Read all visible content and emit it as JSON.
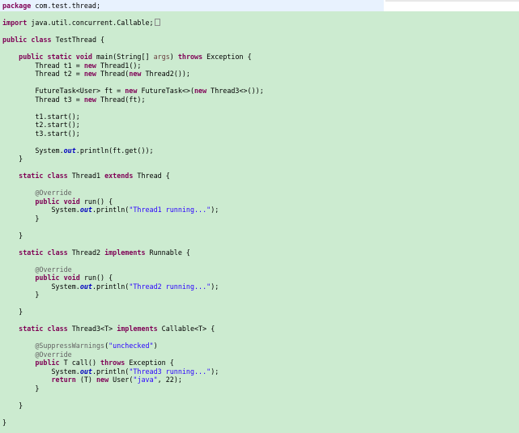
{
  "editor": {
    "language": "java",
    "colors": {
      "background": "#ccebd0",
      "current_line": "#e8f2fe",
      "keyword": "#7f0055",
      "string": "#2a00ff",
      "annotation": "#646464",
      "static_field": "#0000c0",
      "unused_param": "#6a3e3e"
    },
    "lines": [
      [
        {
          "t": "kw",
          "v": "package"
        },
        {
          "t": "plain",
          "v": " com.test.thread;"
        }
      ],
      [],
      [
        {
          "t": "kw",
          "v": "import"
        },
        {
          "t": "plain",
          "v": " java.util.concurrent.Callable;"
        }
      ],
      [],
      [
        {
          "t": "kw",
          "v": "public"
        },
        {
          "t": "plain",
          "v": " "
        },
        {
          "t": "kw",
          "v": "class"
        },
        {
          "t": "plain",
          "v": " TestThread {"
        }
      ],
      [],
      [
        {
          "t": "plain",
          "v": "    "
        },
        {
          "t": "kw",
          "v": "public"
        },
        {
          "t": "plain",
          "v": " "
        },
        {
          "t": "kw",
          "v": "static"
        },
        {
          "t": "plain",
          "v": " "
        },
        {
          "t": "kw",
          "v": "void"
        },
        {
          "t": "plain",
          "v": " main(String[] "
        },
        {
          "t": "var",
          "v": "args"
        },
        {
          "t": "plain",
          "v": ") "
        },
        {
          "t": "kw",
          "v": "throws"
        },
        {
          "t": "plain",
          "v": " Exception {"
        }
      ],
      [
        {
          "t": "plain",
          "v": "        Thread t1 = "
        },
        {
          "t": "kw",
          "v": "new"
        },
        {
          "t": "plain",
          "v": " Thread1();"
        }
      ],
      [
        {
          "t": "plain",
          "v": "        Thread t2 = "
        },
        {
          "t": "kw",
          "v": "new"
        },
        {
          "t": "plain",
          "v": " Thread("
        },
        {
          "t": "kw",
          "v": "new"
        },
        {
          "t": "plain",
          "v": " Thread2());"
        }
      ],
      [],
      [
        {
          "t": "plain",
          "v": "        FutureTask<User> ft = "
        },
        {
          "t": "kw",
          "v": "new"
        },
        {
          "t": "plain",
          "v": " FutureTask<>("
        },
        {
          "t": "kw",
          "v": "new"
        },
        {
          "t": "plain",
          "v": " Thread3<>());"
        }
      ],
      [
        {
          "t": "plain",
          "v": "        Thread t3 = "
        },
        {
          "t": "kw",
          "v": "new"
        },
        {
          "t": "plain",
          "v": " Thread(ft);"
        }
      ],
      [],
      [
        {
          "t": "plain",
          "v": "        t1.start();"
        }
      ],
      [
        {
          "t": "plain",
          "v": "        t2.start();"
        }
      ],
      [
        {
          "t": "plain",
          "v": "        t3.start();"
        }
      ],
      [],
      [
        {
          "t": "plain",
          "v": "        System."
        },
        {
          "t": "field",
          "v": "out"
        },
        {
          "t": "plain",
          "v": ".println(ft.get());"
        }
      ],
      [
        {
          "t": "plain",
          "v": "    }"
        }
      ],
      [],
      [
        {
          "t": "plain",
          "v": "    "
        },
        {
          "t": "kw",
          "v": "static"
        },
        {
          "t": "plain",
          "v": " "
        },
        {
          "t": "kw",
          "v": "class"
        },
        {
          "t": "plain",
          "v": " Thread1 "
        },
        {
          "t": "kw",
          "v": "extends"
        },
        {
          "t": "plain",
          "v": " Thread {"
        }
      ],
      [],
      [
        {
          "t": "plain",
          "v": "        "
        },
        {
          "t": "ann",
          "v": "@Override"
        }
      ],
      [
        {
          "t": "plain",
          "v": "        "
        },
        {
          "t": "kw",
          "v": "public"
        },
        {
          "t": "plain",
          "v": " "
        },
        {
          "t": "kw",
          "v": "void"
        },
        {
          "t": "plain",
          "v": " run() {"
        }
      ],
      [
        {
          "t": "plain",
          "v": "            System."
        },
        {
          "t": "field",
          "v": "out"
        },
        {
          "t": "plain",
          "v": ".println("
        },
        {
          "t": "str",
          "v": "\"Thread1 running...\""
        },
        {
          "t": "plain",
          "v": ");"
        }
      ],
      [
        {
          "t": "plain",
          "v": "        }"
        }
      ],
      [],
      [
        {
          "t": "plain",
          "v": "    }"
        }
      ],
      [],
      [
        {
          "t": "plain",
          "v": "    "
        },
        {
          "t": "kw",
          "v": "static"
        },
        {
          "t": "plain",
          "v": " "
        },
        {
          "t": "kw",
          "v": "class"
        },
        {
          "t": "plain",
          "v": " Thread2 "
        },
        {
          "t": "kw",
          "v": "implements"
        },
        {
          "t": "plain",
          "v": " Runnable {"
        }
      ],
      [],
      [
        {
          "t": "plain",
          "v": "        "
        },
        {
          "t": "ann",
          "v": "@Override"
        }
      ],
      [
        {
          "t": "plain",
          "v": "        "
        },
        {
          "t": "kw",
          "v": "public"
        },
        {
          "t": "plain",
          "v": " "
        },
        {
          "t": "kw",
          "v": "void"
        },
        {
          "t": "plain",
          "v": " run() {"
        }
      ],
      [
        {
          "t": "plain",
          "v": "            System."
        },
        {
          "t": "field",
          "v": "out"
        },
        {
          "t": "plain",
          "v": ".println("
        },
        {
          "t": "str",
          "v": "\"Thread2 running...\""
        },
        {
          "t": "plain",
          "v": ");"
        }
      ],
      [
        {
          "t": "plain",
          "v": "        }"
        }
      ],
      [],
      [
        {
          "t": "plain",
          "v": "    }"
        }
      ],
      [],
      [
        {
          "t": "plain",
          "v": "    "
        },
        {
          "t": "kw",
          "v": "static"
        },
        {
          "t": "plain",
          "v": " "
        },
        {
          "t": "kw",
          "v": "class"
        },
        {
          "t": "plain",
          "v": " Thread3<T> "
        },
        {
          "t": "kw",
          "v": "implements"
        },
        {
          "t": "plain",
          "v": " Callable<T> {"
        }
      ],
      [],
      [
        {
          "t": "plain",
          "v": "        "
        },
        {
          "t": "ann",
          "v": "@SuppressWarnings"
        },
        {
          "t": "plain",
          "v": "("
        },
        {
          "t": "str",
          "v": "\"unchecked\""
        },
        {
          "t": "plain",
          "v": ")"
        }
      ],
      [
        {
          "t": "plain",
          "v": "        "
        },
        {
          "t": "ann",
          "v": "@Override"
        }
      ],
      [
        {
          "t": "plain",
          "v": "        "
        },
        {
          "t": "kw",
          "v": "public"
        },
        {
          "t": "plain",
          "v": " T call() "
        },
        {
          "t": "kw",
          "v": "throws"
        },
        {
          "t": "plain",
          "v": " Exception {"
        }
      ],
      [
        {
          "t": "plain",
          "v": "            System."
        },
        {
          "t": "field",
          "v": "out"
        },
        {
          "t": "plain",
          "v": ".println("
        },
        {
          "t": "str",
          "v": "\"Thread3 running...\""
        },
        {
          "t": "plain",
          "v": ");"
        }
      ],
      [
        {
          "t": "plain",
          "v": "            "
        },
        {
          "t": "kw",
          "v": "return"
        },
        {
          "t": "plain",
          "v": " (T) "
        },
        {
          "t": "kw",
          "v": "new"
        },
        {
          "t": "plain",
          "v": " User("
        },
        {
          "t": "str",
          "v": "\"java\""
        },
        {
          "t": "plain",
          "v": ", 22);"
        }
      ],
      [
        {
          "t": "plain",
          "v": "        }"
        }
      ],
      [],
      [
        {
          "t": "plain",
          "v": "    }"
        }
      ],
      [],
      [
        {
          "t": "plain",
          "v": "}"
        }
      ]
    ]
  }
}
